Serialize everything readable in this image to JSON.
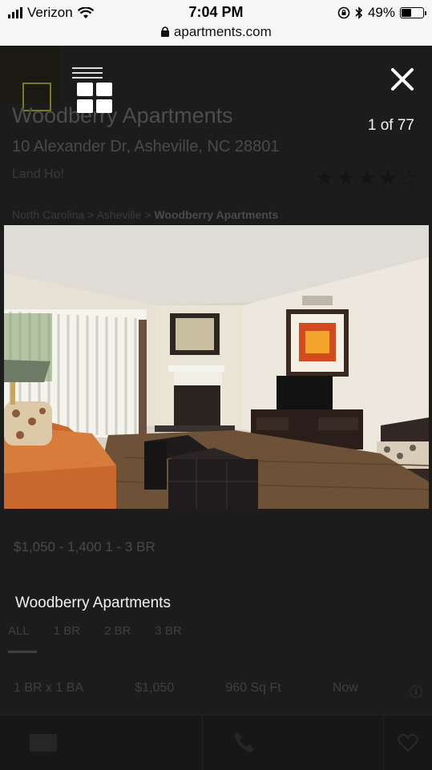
{
  "status_bar": {
    "carrier": "Verizon",
    "time": "7:04 PM",
    "battery": "49%",
    "battery_level": 0.49,
    "url": "apartments.com"
  },
  "background_page": {
    "title": "Woodberry Apartments",
    "address": "10 Alexander Dr, Asheville, NC 28801",
    "city_link": "Land Ho!",
    "rating_stars": 4,
    "breadcrumb": [
      "North Carolina",
      "Asheville",
      "Woodberry Apartments"
    ],
    "price_summary": "$1,050 - 1,400   1 - 3 BR",
    "tabs": [
      "ALL",
      "1 BR",
      "2 BR",
      "3 BR"
    ],
    "row": {
      "beds": "1 BR x 1 BA",
      "price": "$1,050",
      "sqft": "960 Sq Ft",
      "avail": "Now"
    }
  },
  "lightbox": {
    "counter": "1 of 77",
    "caption": "Woodberry Apartments",
    "icons": {
      "close": "close-icon",
      "grid": "grid-view-icon"
    }
  },
  "colors": {
    "overlay": "#161616",
    "text": "#f2f2f2",
    "accent": "#7a7a22"
  }
}
